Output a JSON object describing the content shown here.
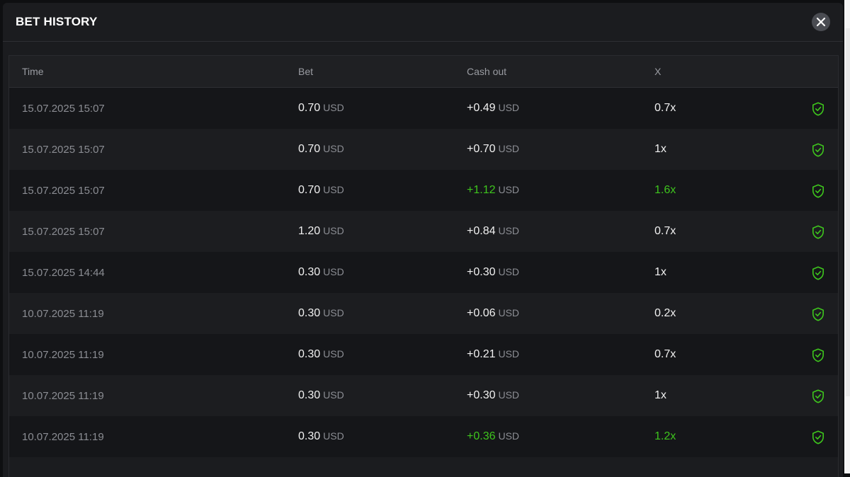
{
  "modal": {
    "title": "BET HISTORY",
    "close_icon": "close-icon"
  },
  "table": {
    "headers": {
      "time": "Time",
      "bet": "Bet",
      "cash_out": "Cash out",
      "multiplier": "X"
    },
    "currency": "USD",
    "accent_color": "#3ec51d",
    "rows": [
      {
        "time": "15.07.2025 15:07",
        "bet": "0.70",
        "cash_out": "+0.49",
        "multiplier": "0.7x",
        "win": false
      },
      {
        "time": "15.07.2025 15:07",
        "bet": "0.70",
        "cash_out": "+0.70",
        "multiplier": "1x",
        "win": false
      },
      {
        "time": "15.07.2025 15:07",
        "bet": "0.70",
        "cash_out": "+1.12",
        "multiplier": "1.6x",
        "win": true
      },
      {
        "time": "15.07.2025 15:07",
        "bet": "1.20",
        "cash_out": "+0.84",
        "multiplier": "0.7x",
        "win": false
      },
      {
        "time": "15.07.2025 14:44",
        "bet": "0.30",
        "cash_out": "+0.30",
        "multiplier": "1x",
        "win": false
      },
      {
        "time": "10.07.2025 11:19",
        "bet": "0.30",
        "cash_out": "+0.06",
        "multiplier": "0.2x",
        "win": false
      },
      {
        "time": "10.07.2025 11:19",
        "bet": "0.30",
        "cash_out": "+0.21",
        "multiplier": "0.7x",
        "win": false
      },
      {
        "time": "10.07.2025 11:19",
        "bet": "0.30",
        "cash_out": "+0.30",
        "multiplier": "1x",
        "win": false
      },
      {
        "time": "10.07.2025 11:19",
        "bet": "0.30",
        "cash_out": "+0.36",
        "multiplier": "1.2x",
        "win": true
      }
    ],
    "row_icon": "shield-check-icon"
  }
}
